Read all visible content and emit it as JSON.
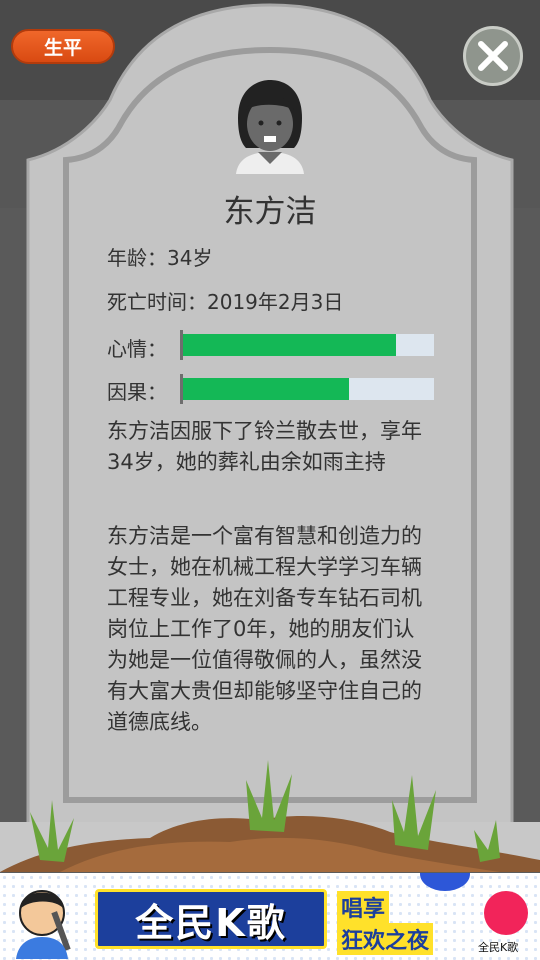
{
  "header": {
    "life_button_label": "生平",
    "close_icon": "close-icon"
  },
  "profile": {
    "name": "东方洁",
    "age_text": "年龄：34岁",
    "death_time_text": "死亡时间：2019年2月3日"
  },
  "stats": {
    "mood_label": "心情：",
    "mood_value": 0.85,
    "karma_label": "因果：",
    "karma_value": 0.66,
    "bar_color": "#14b856",
    "track_color": "#dde6ef"
  },
  "story": {
    "death_paragraph": "东方洁因服下了铃兰散去世，享年34岁，她的葬礼由余如雨主持",
    "bio_paragraph": "东方洁是一个富有智慧和创造力的女士，她在机械工程大学学习车辆工程专业，她在刘备专车钻石司机岗位上工作了0年，她的朋友们认为她是一位值得敬佩的人，虽然没有大富大贵但却能够坚守住自己的道德底线。"
  },
  "ad": {
    "title": "全民K歌",
    "sub_line1": "唱享",
    "sub_line2": "狂欢之夜",
    "brand": "全民K歌"
  }
}
